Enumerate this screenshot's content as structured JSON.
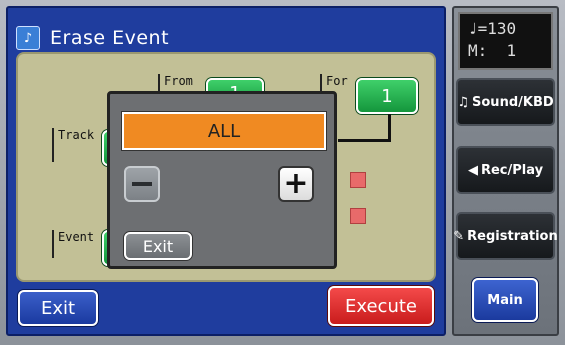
{
  "window": {
    "title": "Erase Event",
    "title_icon": "note-sparkle-icon"
  },
  "fields": {
    "from_label": "From",
    "from_value": "1",
    "for_label": "For",
    "for_value": "1",
    "track_label": "Track",
    "event_label": "Event"
  },
  "popup": {
    "value": "ALL",
    "minus_label": "−",
    "plus_label": "+",
    "exit_label": "Exit"
  },
  "footer": {
    "exit_label": "Exit",
    "execute_label": "Execute"
  },
  "sidebar": {
    "lcd_line1": "♩=130",
    "lcd_line2": "M:  1",
    "buttons": [
      {
        "label": "Sound/KBD",
        "icon": "notes-icon",
        "glyph": "♫"
      },
      {
        "label": "Rec/Play",
        "icon": "speaker-icon",
        "glyph": "◀"
      },
      {
        "label": "Registration",
        "icon": "book-icon",
        "glyph": "✎"
      }
    ],
    "main_label": "Main"
  },
  "colors": {
    "window_blue": "#1f3d9e",
    "panel_khaki": "#c2c096",
    "green": "#14963c",
    "orange": "#f08a22",
    "red": "#c91c1c"
  }
}
